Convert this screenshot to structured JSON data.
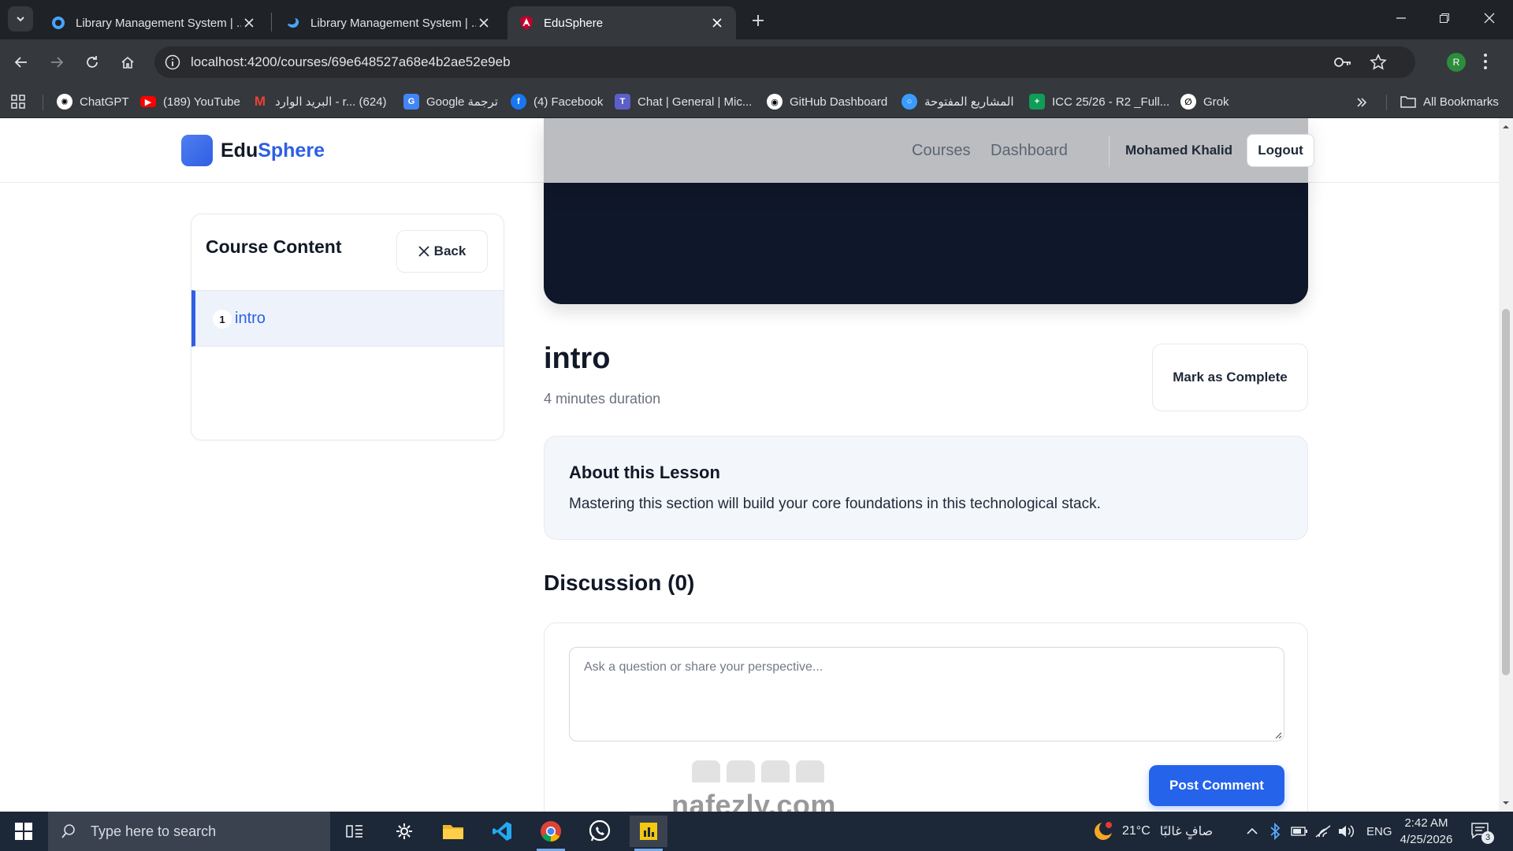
{
  "browser": {
    "tabs": [
      {
        "title": "Library Management System | ...",
        "active": false
      },
      {
        "title": "Library Management System | ...",
        "active": false
      },
      {
        "title": "EduSphere",
        "active": true
      }
    ],
    "url": "localhost:4200/courses/69e648527a68e4b2ae52e9eb",
    "profile_initial": "R",
    "bookmarks": [
      {
        "label": "ChatGPT",
        "icon": "chatgpt-icon"
      },
      {
        "label": "(189) YouTube",
        "icon": "youtube-icon"
      },
      {
        "label": "البريد الوارد - r... (624)",
        "icon": "gmail-icon"
      },
      {
        "label": "Google ترجمة",
        "icon": "google-translate-icon"
      },
      {
        "label": "(4) Facebook",
        "icon": "facebook-icon"
      },
      {
        "label": "Chat | General | Mic...",
        "icon": "teams-icon"
      },
      {
        "label": "GitHub Dashboard",
        "icon": "github-icon"
      },
      {
        "label": "المشاريع المفتوحة",
        "icon": "projects-icon"
      },
      {
        "label": "ICC 25/26 - R2 _Full...",
        "icon": "sheets-icon"
      },
      {
        "label": "Grok",
        "icon": "grok-icon"
      }
    ],
    "all_bookmarks": "All Bookmarks"
  },
  "header": {
    "logo_prefix": "Edu",
    "logo_accent": "Sphere",
    "nav": [
      "Courses",
      "Dashboard"
    ],
    "user_name": "Mohamed Khalid",
    "logout_label": "Logout"
  },
  "sidebar": {
    "title": "Course Content",
    "back_label": "Back",
    "lessons": [
      {
        "number": "1",
        "label": "intro"
      }
    ]
  },
  "lesson": {
    "title": "intro",
    "duration": "4 minutes duration",
    "complete_label": "Mark as Complete"
  },
  "about": {
    "title": "About this Lesson",
    "text": "Mastering this section will build your core foundations in this technological stack."
  },
  "discussion": {
    "title": "Discussion (0)",
    "placeholder": "Ask a question or share your perspective...",
    "post_label": "Post Comment"
  },
  "watermark": "nafezly.com",
  "taskbar": {
    "search_placeholder": "Type here to search",
    "weather": "21°C",
    "weather_desc": "صافٍ غالبًا",
    "language": "ENG",
    "time": "2:42 AM",
    "date": "4/25/2026",
    "notifications": "3"
  },
  "colors": {
    "brand": "#2e5fe4",
    "primary_button": "#2563eb",
    "video_bg": "#0f172a"
  }
}
